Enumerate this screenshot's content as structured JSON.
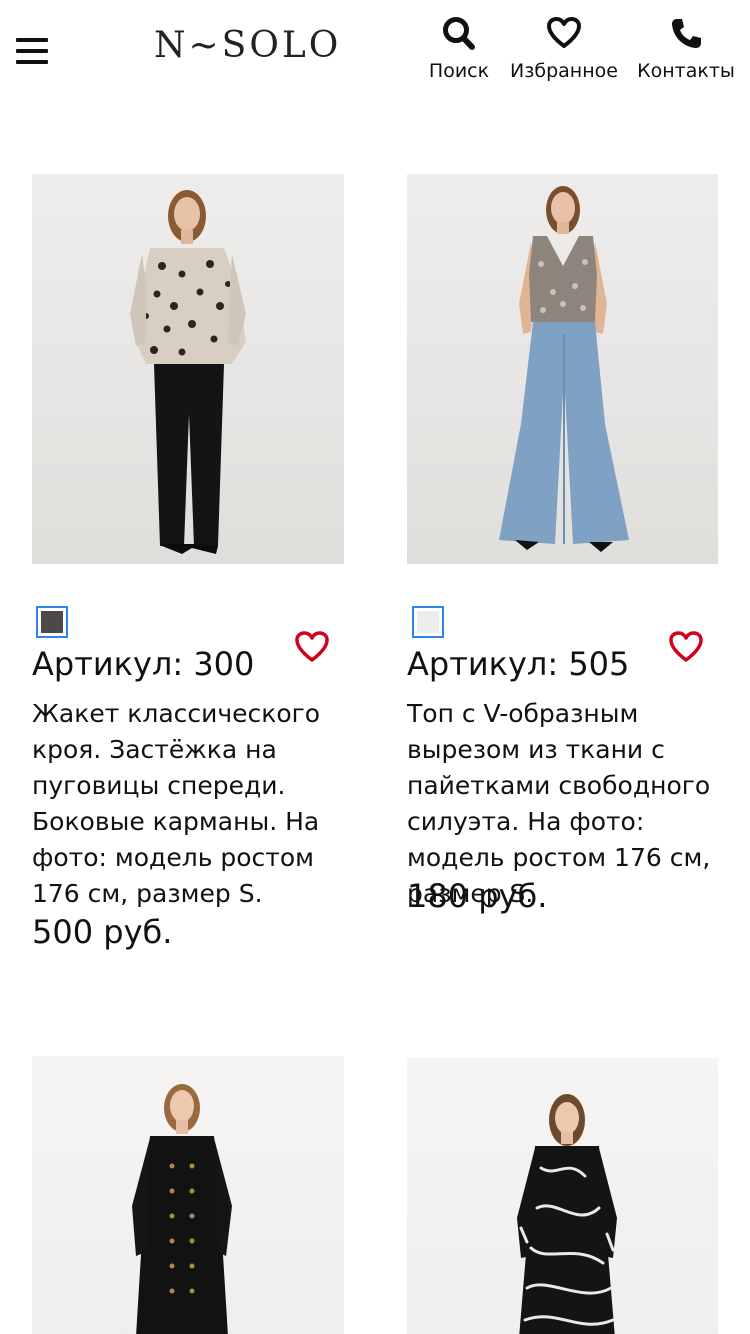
{
  "header": {
    "logo": "N~SOLO",
    "menu_icon": "hamburger-menu-icon",
    "nav": [
      {
        "label": "Поиск",
        "icon": "search-icon"
      },
      {
        "label": "Избранное",
        "icon": "heart-icon"
      },
      {
        "label": "Контакты",
        "icon": "phone-icon"
      }
    ]
  },
  "colors": {
    "accent_heart": "#d0021b",
    "swatch_border": "#2f86e6"
  },
  "products": [
    {
      "sku": "Артикул: 300",
      "description": "Жакет классического кроя. Застёжка на пуговицы спереди. Боковые карманы. На фото: модель ростом 176 см, размер S.",
      "price": "500 руб.",
      "swatch_color": "#4d4948"
    },
    {
      "sku": "Артикул: 505",
      "description": "Топ с V-образным вырезом из ткани с пайетками свободного силуэта. На фото: модель ростом 176 см, размер S.",
      "price": "180 руб.",
      "swatch_color": "#ececec"
    },
    {},
    {}
  ]
}
